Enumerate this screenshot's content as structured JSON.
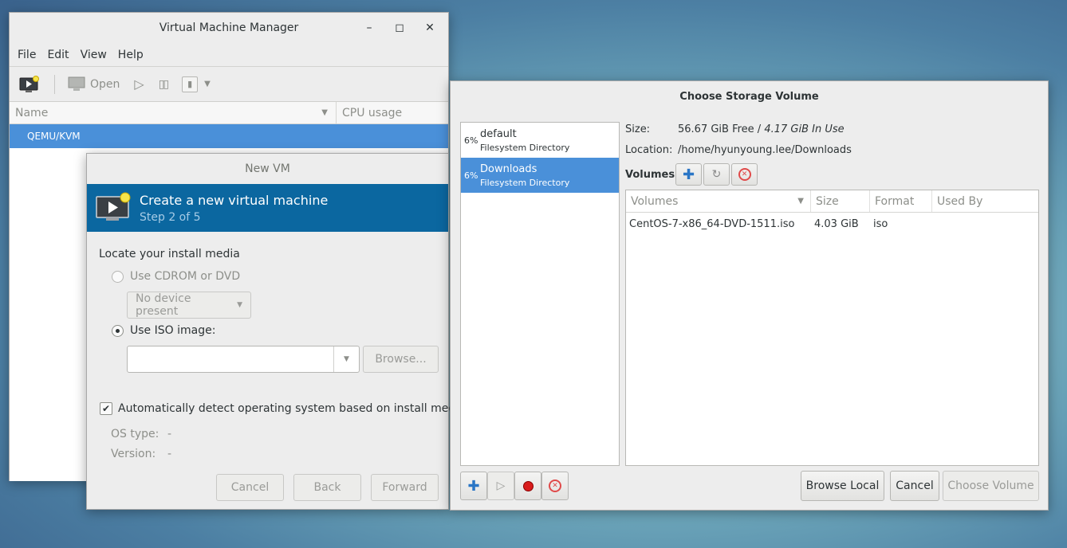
{
  "main": {
    "title": "Virtual Machine Manager",
    "menu": [
      "File",
      "Edit",
      "View",
      "Help"
    ],
    "toolbar": {
      "open_label": "Open"
    },
    "columns": {
      "name": "Name",
      "cpu": "CPU usage"
    },
    "row": "QEMU/KVM"
  },
  "newvm": {
    "title": "New VM",
    "banner_title": "Create a new virtual machine",
    "banner_step": "Step 2 of 5",
    "locate_label": "Locate your install media",
    "cdrom_label": "Use CDROM or DVD",
    "no_device": "No device present",
    "iso_label": "Use ISO image:",
    "iso_value": "",
    "browse_label": "Browse...",
    "auto_detect_label": "Automatically detect operating system based on install media",
    "os_type_label": "OS type:",
    "os_type_value": "-",
    "version_label": "Version:",
    "version_value": "-",
    "cancel": "Cancel",
    "back": "Back",
    "forward": "Forward"
  },
  "storage": {
    "title": "Choose Storage Volume",
    "pools": [
      {
        "pct": "6%",
        "name": "default",
        "type": "Filesystem Directory"
      },
      {
        "pct": "6%",
        "name": "Downloads",
        "type": "Filesystem Directory"
      }
    ],
    "size_label": "Size:",
    "size_free": "56.67 GiB Free / ",
    "size_used": "4.17 GiB In Use",
    "location_label": "Location:",
    "location_value": "/home/hyunyoung.lee/Downloads",
    "volumes_label": "Volumes",
    "columns": {
      "volumes": "Volumes",
      "size": "Size",
      "format": "Format",
      "used_by": "Used By"
    },
    "rows": [
      {
        "name": "CentOS-7-x86_64-DVD-1511.iso",
        "size": "4.03 GiB",
        "format": "iso",
        "used_by": ""
      }
    ],
    "browse_local": "Browse Local",
    "cancel": "Cancel",
    "choose_volume": "Choose Volume"
  },
  "colors": {
    "selection": "#4a90d9",
    "banner": "#0b67a0"
  }
}
